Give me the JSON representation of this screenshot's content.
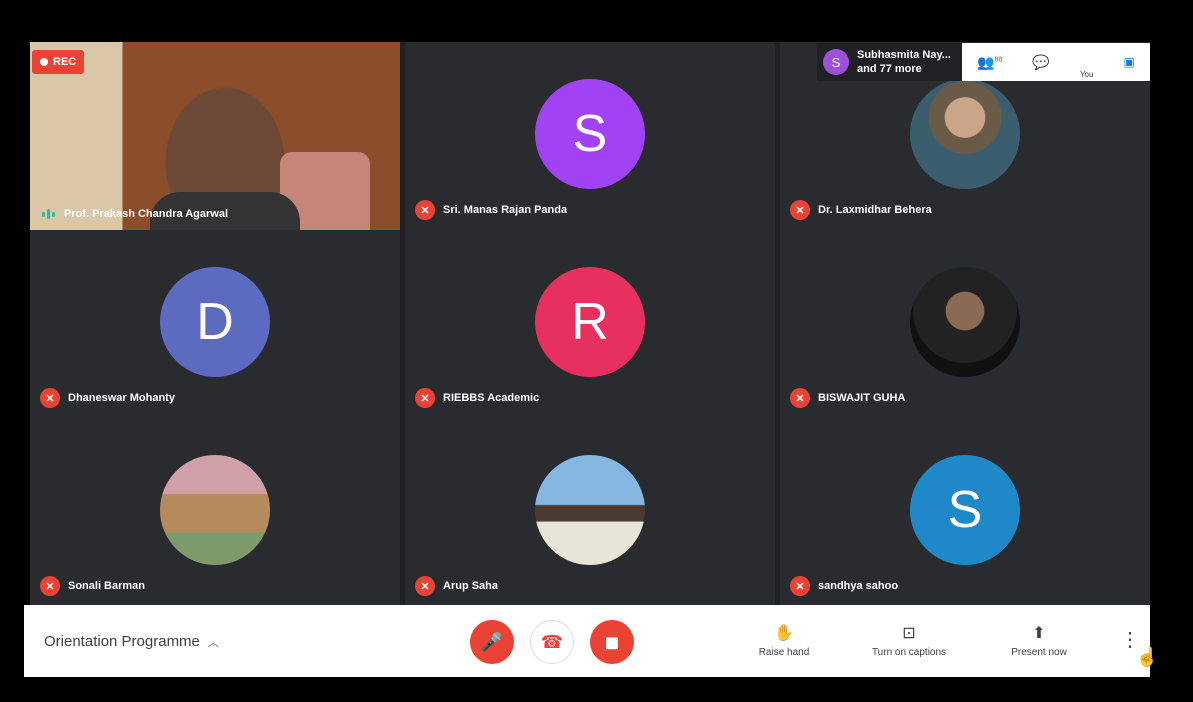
{
  "recording": {
    "label": "REC"
  },
  "participants_panel": {
    "initial": "S",
    "line1": "Subhasmita Nay...",
    "line2": "and 77 more"
  },
  "toolbar": {
    "people_icon": "people-icon",
    "chat_icon": "chat-icon",
    "you_label": "You",
    "people_count": "88"
  },
  "tiles": [
    {
      "name": "Prof. Prakash Chandra Agarwal",
      "type": "video"
    },
    {
      "name": "Sri. Manas Rajan Panda",
      "initial": "S",
      "color": "#a142f4"
    },
    {
      "name": "Dr. Laxmidhar Behera",
      "type": "photo"
    },
    {
      "name": "Dhaneswar Mohanty",
      "initial": "D",
      "color": "#5c6bc0"
    },
    {
      "name": "RIEBBS Academic",
      "initial": "R",
      "color": "#e8305f"
    },
    {
      "name": "BISWAJIT GUHA",
      "type": "photo"
    },
    {
      "name": "Sonali Barman",
      "type": "photo"
    },
    {
      "name": "Arup Saha",
      "type": "photo"
    },
    {
      "name": "sandhya sahoo",
      "initial": "S",
      "color": "#1e88c8"
    }
  ],
  "bottom_bar": {
    "meeting_title": "Orientation Programme",
    "raise_hand": "Raise hand",
    "captions": "Turn on captions",
    "present": "Present now"
  }
}
